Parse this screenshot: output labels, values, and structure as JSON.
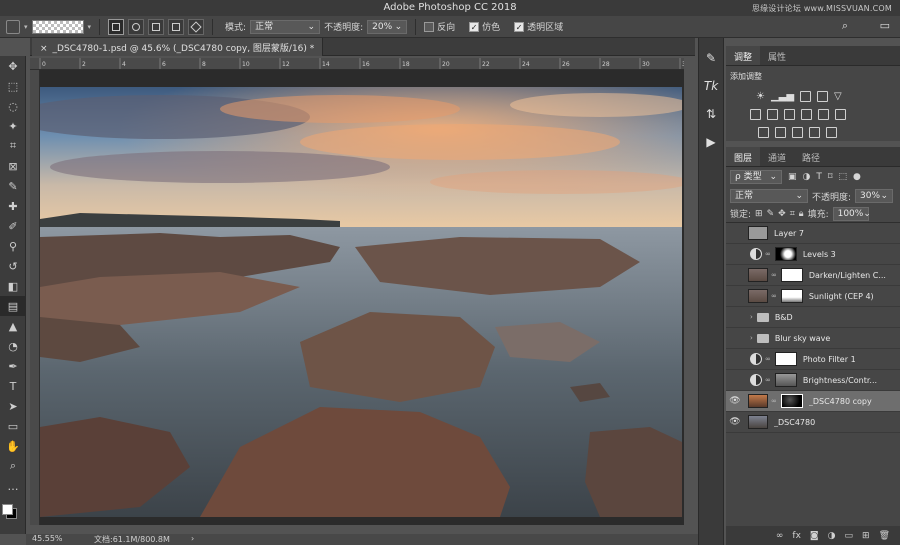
{
  "app": {
    "title": "Adobe Photoshop CC 2018",
    "watermark": "思缘设计论坛 www.MISSVUAN.COM"
  },
  "options": {
    "mode_label": "模式:",
    "mode_value": "正常",
    "opacity_label": "不透明度:",
    "opacity_value": "20%",
    "reverse_label": "反向",
    "dither_label": "仿色",
    "transparency_label": "透明区域",
    "reverse_checked": false,
    "dither_checked": true,
    "transparency_checked": true
  },
  "document": {
    "tab_title": "_DSC4780-1.psd @ 45.6% (_DSC4780 copy, 图层蒙版/16) *"
  },
  "status": {
    "zoom": "45.55%",
    "doc_size": "文档:61.1M/800.8M",
    "arrow": "›"
  },
  "ruler": {
    "ticks": [
      "0",
      "2",
      "4",
      "6",
      "8",
      "10",
      "12",
      "14",
      "16",
      "18",
      "20",
      "22",
      "24",
      "26",
      "28",
      "30",
      "32"
    ]
  },
  "adjustments_panel": {
    "tabs": [
      "调整",
      "属性"
    ],
    "add_label": "添加调整"
  },
  "layers_panel": {
    "tabs": [
      "图层",
      "通道",
      "路径"
    ],
    "filter_label": "ρ 类型",
    "blend_mode": "正常",
    "opacity_label": "不透明度:",
    "opacity_value": "30%",
    "lock_label": "锁定:",
    "fill_label": "填充:",
    "fill_value": "100%",
    "layers": [
      {
        "name": "Layer 7",
        "kind": "pixel",
        "visible": false,
        "thumb": "#9a9a9a"
      },
      {
        "name": "Levels 3",
        "kind": "adjust",
        "visible": false
      },
      {
        "name": "Darken/Lighten C...",
        "kind": "pixel-mask",
        "visible": false,
        "thumb": "#6a5a52"
      },
      {
        "name": "Sunlight (CEP 4)",
        "kind": "pixel-mask",
        "visible": false,
        "thumb": "#6a5a52"
      },
      {
        "name": "B&D",
        "kind": "group",
        "visible": false
      },
      {
        "name": "Blur sky wave",
        "kind": "group",
        "visible": false
      },
      {
        "name": "Photo Filter 1",
        "kind": "adjust",
        "visible": false
      },
      {
        "name": "Brightness/Contr...",
        "kind": "adjust-gray",
        "visible": false
      },
      {
        "name": "_DSC4780 copy",
        "kind": "pixel-mask",
        "visible": true,
        "thumb": "#a8613a",
        "selected": true
      },
      {
        "name": "_DSC4780",
        "kind": "smart",
        "visible": true,
        "thumb": "#6b6e74"
      }
    ]
  },
  "colors": {
    "panel_bg": "#464646",
    "selected_layer": "#6e6e6e",
    "chrome": "#3a3a3a"
  }
}
